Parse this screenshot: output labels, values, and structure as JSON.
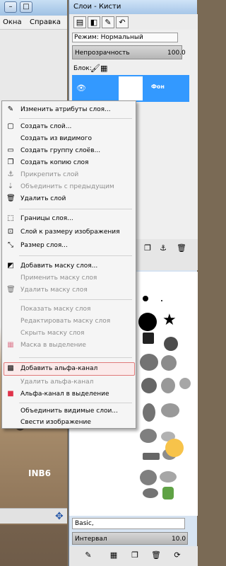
{
  "main_window": {
    "menu": [
      "Окна",
      "Справка"
    ],
    "canvas_text": "INB6",
    "nav_icon": "move-icon"
  },
  "dock": {
    "title": "Слои - Кисти",
    "layers": {
      "mode_label": "Режим: Нормальный",
      "opacity_label": "Непрозрачность",
      "opacity_value": "100.0",
      "lock_label": "Блок:",
      "layer_name": "Фон"
    },
    "brushes": {
      "preset": "Basic,",
      "interval_label": "Интервал",
      "interval_value": "10.0"
    }
  },
  "context_menu": {
    "items": [
      {
        "label": "Изменить атрибуты слоя...",
        "icon": "edit-icon",
        "disabled": false
      },
      {
        "label": "Создать слой...",
        "icon": "new-layer-icon",
        "disabled": false
      },
      {
        "label": "Создать из видимого",
        "icon": "",
        "disabled": false
      },
      {
        "label": "Создать группу слоёв...",
        "icon": "folder-icon",
        "disabled": false
      },
      {
        "label": "Создать копию слоя",
        "icon": "duplicate-icon",
        "disabled": false
      },
      {
        "label": "Прикрепить слой",
        "icon": "anchor-icon",
        "disabled": true
      },
      {
        "label": "Объединить с предыдущим",
        "icon": "merge-icon",
        "disabled": true
      },
      {
        "label": "Удалить слой",
        "icon": "trash-icon",
        "disabled": false
      },
      {
        "label": "Границы слоя...",
        "icon": "bounds-icon",
        "disabled": false
      },
      {
        "label": "Слой к размеру изображения",
        "icon": "fit-icon",
        "disabled": false
      },
      {
        "label": "Размер слоя...",
        "icon": "resize-icon",
        "disabled": false
      },
      {
        "label": "Добавить маску слоя...",
        "icon": "mask-icon",
        "disabled": false
      },
      {
        "label": "Применить маску слоя",
        "icon": "",
        "disabled": true
      },
      {
        "label": "Удалить маску слоя",
        "icon": "trash-icon",
        "disabled": true
      },
      {
        "label": "Показать маску слоя",
        "icon": "",
        "disabled": true
      },
      {
        "label": "Редактировать маску слоя",
        "icon": "",
        "disabled": true
      },
      {
        "label": "Скрыть маску слоя",
        "icon": "",
        "disabled": true
      },
      {
        "label": "Маска в выделение",
        "icon": "selection-icon",
        "disabled": true
      },
      {
        "label": "Добавить альфа-канал",
        "icon": "alpha-icon",
        "disabled": false
      },
      {
        "label": "Удалить альфа-канал",
        "icon": "",
        "disabled": true
      },
      {
        "label": "Альфа-канал в выделение",
        "icon": "alpha-selection-icon",
        "disabled": false
      },
      {
        "label": "Объединить видимые слои...",
        "icon": "",
        "disabled": false
      },
      {
        "label": "Свести изображение",
        "icon": "",
        "disabled": false
      }
    ]
  }
}
